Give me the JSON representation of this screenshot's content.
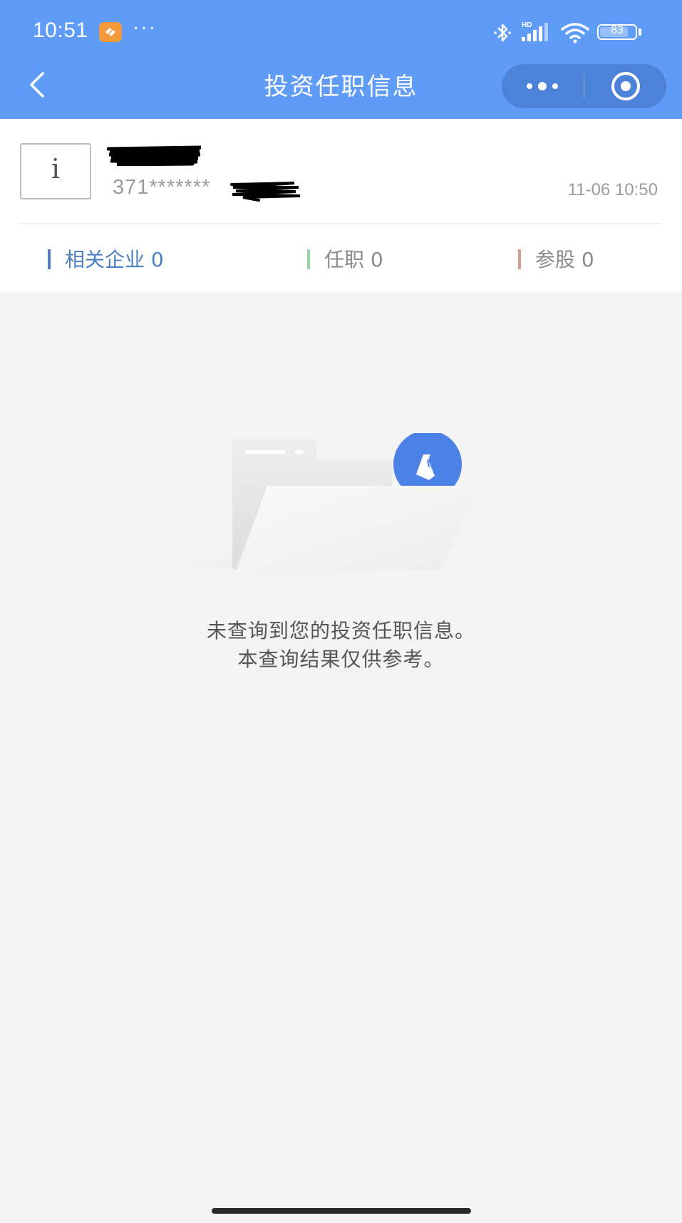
{
  "status_bar": {
    "time": "10:51",
    "dots": "···",
    "battery_level": "83",
    "icons": [
      "app-badge-icon",
      "bluetooth-icon",
      "hd-signal-icon",
      "wifi-icon",
      "battery-icon"
    ]
  },
  "nav": {
    "title": "投资任职信息",
    "back_icon": "chevron-left-icon",
    "more_icon": "more-dots-icon",
    "close_icon": "target-close-icon"
  },
  "profile": {
    "info_icon_label": "i",
    "id_prefix": "371*******",
    "timestamp": "11-06 10:50"
  },
  "tabs": [
    {
      "label": "相关企业 0",
      "color": "#4d7fc4"
    },
    {
      "label": "任职 0",
      "color": "#8fd6a6"
    },
    {
      "label": "参股 0",
      "color": "#d59b8f"
    }
  ],
  "empty_state": {
    "line1": "未查询到您的投资任职信息。",
    "line2": "本查询结果仅供参考。",
    "illustration_icon": "empty-folder-icon"
  },
  "colors": {
    "header": "#5f9cf8",
    "capsule": "#4c82d8",
    "background": "#f3f3f4"
  }
}
